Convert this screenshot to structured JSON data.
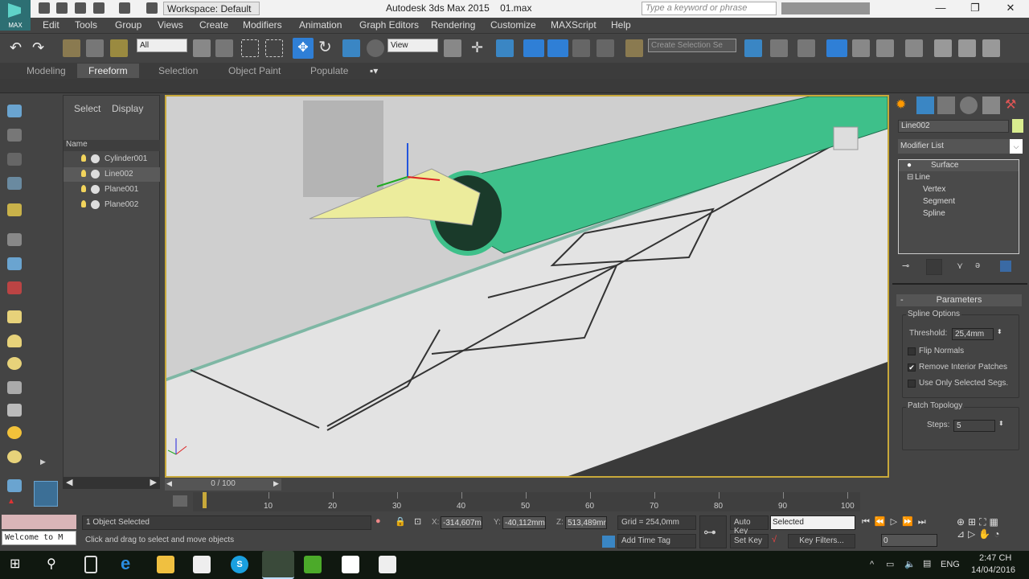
{
  "title_bar": {
    "logo_label": "MAX",
    "workspace": "Workspace: Default",
    "app_title": "Autodesk 3ds Max  2015",
    "file_name": "01.max",
    "search_placeholder": "Type a keyword or phrase",
    "window_buttons": [
      "—",
      "❐",
      "✕"
    ]
  },
  "menu": [
    "Edit",
    "Tools",
    "Group",
    "Views",
    "Create",
    "Modifiers",
    "Animation",
    "Graph Editors",
    "Rendering",
    "Customize",
    "MAXScript",
    "Help"
  ],
  "toolbar": {
    "selection_filter": "All",
    "ref_coord": "View",
    "named_selection_placeholder": "Create Selection Se"
  },
  "ribbon": {
    "tabs": [
      "Modeling",
      "Freeform",
      "Selection",
      "Object Paint",
      "Populate"
    ],
    "active": "Freeform"
  },
  "scene_explorer": {
    "tabs": [
      "Select",
      "Display"
    ],
    "column": "Name",
    "items": [
      "Cylinder001",
      "Line002",
      "Plane001",
      "Plane002"
    ],
    "selected": "Line002"
  },
  "command_panel": {
    "object_name": "Line002",
    "object_color": "#d8ec8f",
    "modifier_list": "Modifier List",
    "stack": {
      "modifier": "Surface",
      "base": "Line",
      "subobjects": [
        "Vertex",
        "Segment",
        "Spline"
      ]
    },
    "rollout": "Parameters",
    "spline_options": {
      "label": "Spline Options",
      "threshold_label": "Threshold:",
      "threshold": "25,4mm",
      "checkboxes": [
        {
          "label": "Flip Normals",
          "checked": false
        },
        {
          "label": "Remove Interior Patches",
          "checked": true
        },
        {
          "label": "Use Only Selected Segs.",
          "checked": false
        }
      ]
    },
    "patch_topology": {
      "label": "Patch Topology",
      "steps_label": "Steps:",
      "steps": "5"
    }
  },
  "timeline": {
    "slider": "0 / 100",
    "ticks": [
      "10",
      "20",
      "30",
      "40",
      "50",
      "60",
      "70",
      "80",
      "90",
      "100"
    ]
  },
  "status": {
    "selection": "1 Object Selected",
    "prompt": "Click and drag to select and move objects",
    "welcome": "Welcome to M",
    "x_label": "X:",
    "x": "-314,607m",
    "y_label": "Y:",
    "y": "-40,112mm",
    "z_label": "Z:",
    "z": "513,489mr",
    "grid": "Grid = 254,0mm",
    "add_time_tag": "Add Time Tag",
    "auto_key": "Auto Key",
    "set_key": "Set Key",
    "key_mode": "Selected",
    "key_filters": "Key Filters...",
    "frame": "0"
  },
  "taskbar": {
    "lang": "ENG",
    "time": "2:47 CH",
    "date": "14/04/2016"
  },
  "colors": {
    "viewport_border": "#c8a93a",
    "cylinder": "#3ec08a",
    "line_surface": "#ecec9c",
    "active_tool": "#2f7fd6"
  }
}
